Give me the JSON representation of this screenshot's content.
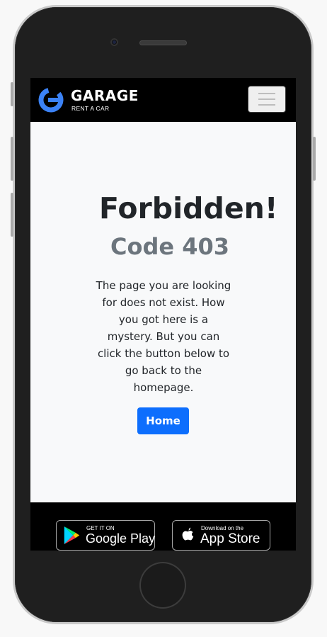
{
  "header": {
    "brand_name": "GARAGE",
    "brand_tagline": "RENT A CAR",
    "menu_icon": "hamburger-menu-icon",
    "logo_icon": "garage-logo-icon"
  },
  "main": {
    "title": "Forbidden!",
    "code": "Code 403",
    "description": "The page you are looking for does not exist. How you got here is a mystery. But you can click the button below to go back to the homepage.",
    "home_button_label": "Home"
  },
  "footer": {
    "google_play": {
      "small_text": "GET IT ON",
      "big_text": "Google Play",
      "icon": "google-play-icon"
    },
    "app_store": {
      "small_text": "Download on the",
      "big_text": "App Store",
      "icon": "apple-icon"
    }
  },
  "colors": {
    "accent": "#0d6efd",
    "logo_blue": "#3b82f6",
    "navbar_bg": "#000000",
    "page_bg": "#f8f9fa",
    "heading": "#212529",
    "muted": "#6c757d"
  }
}
